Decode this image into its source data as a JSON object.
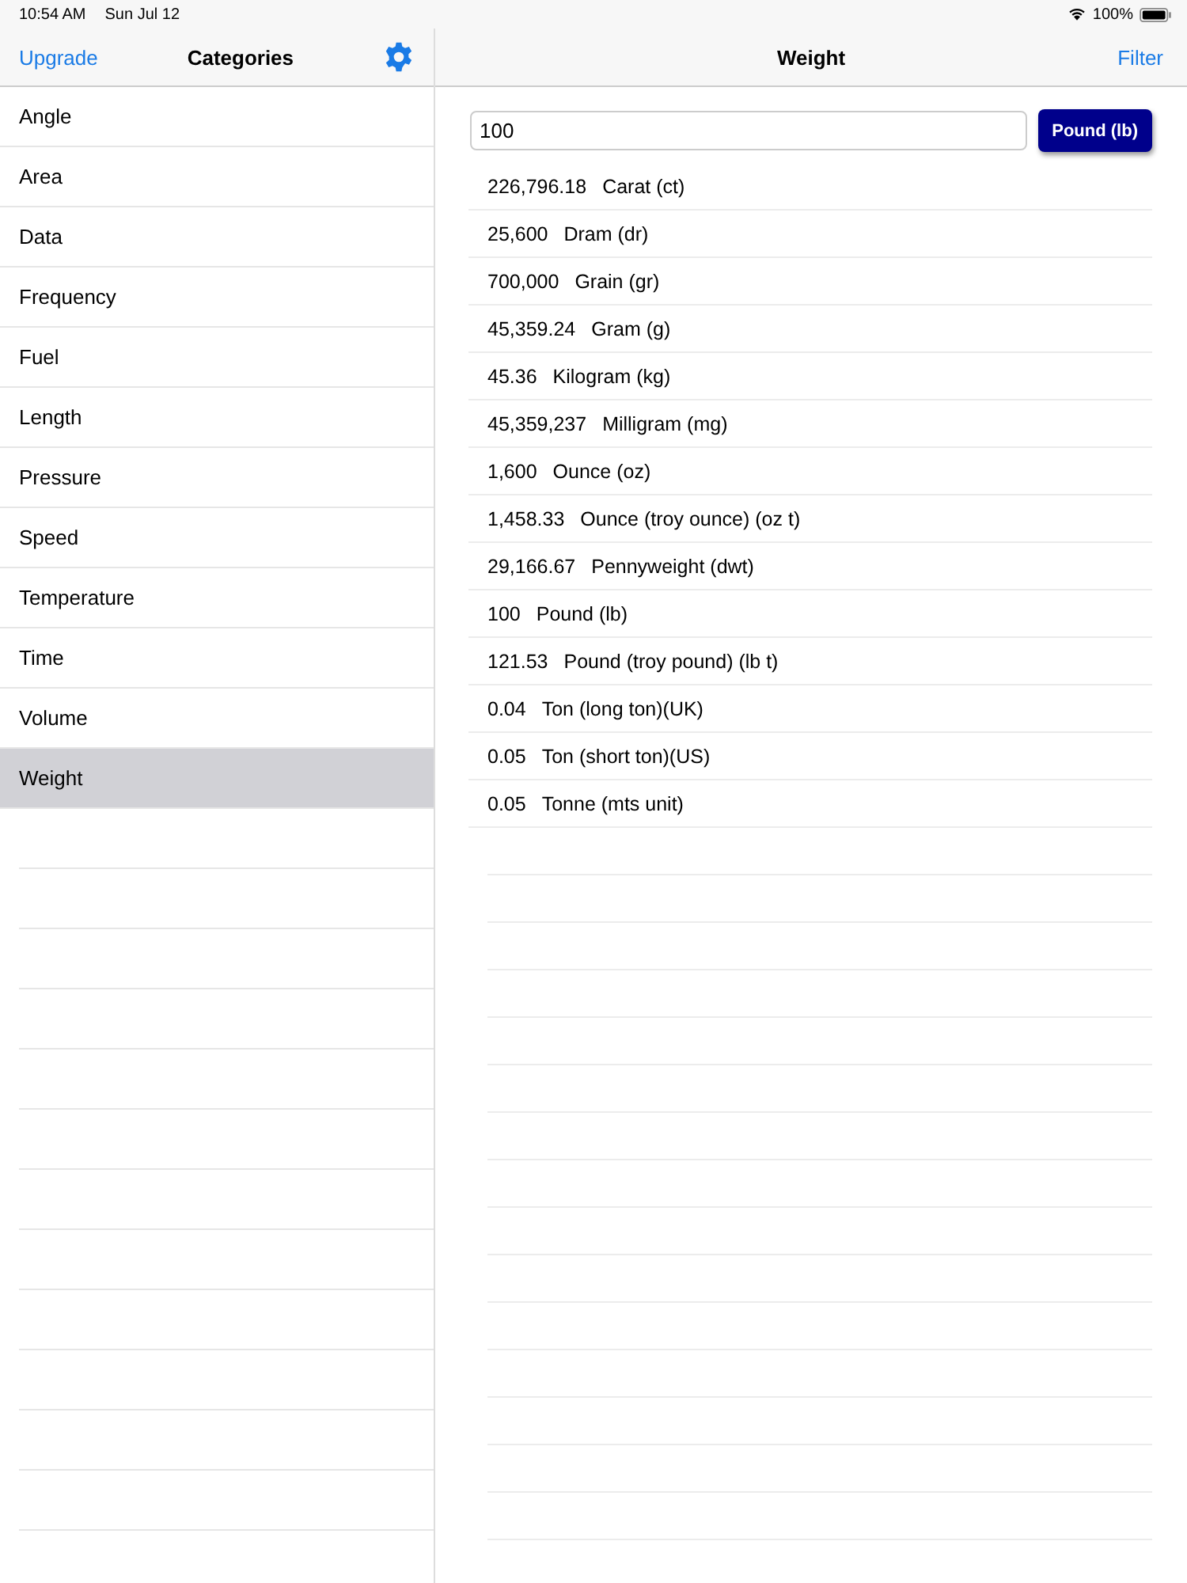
{
  "status_bar": {
    "time": "10:54 AM",
    "date": "Sun Jul 12",
    "battery": "100%"
  },
  "sidebar": {
    "upgrade": "Upgrade",
    "title": "Categories",
    "items": [
      {
        "label": "Angle",
        "selected": false
      },
      {
        "label": "Area",
        "selected": false
      },
      {
        "label": "Data",
        "selected": false
      },
      {
        "label": "Frequency",
        "selected": false
      },
      {
        "label": "Fuel",
        "selected": false
      },
      {
        "label": "Length",
        "selected": false
      },
      {
        "label": "Pressure",
        "selected": false
      },
      {
        "label": "Speed",
        "selected": false
      },
      {
        "label": "Temperature",
        "selected": false
      },
      {
        "label": "Time",
        "selected": false
      },
      {
        "label": "Volume",
        "selected": false
      },
      {
        "label": "Weight",
        "selected": true
      }
    ]
  },
  "main": {
    "title": "Weight",
    "filter": "Filter",
    "input": {
      "value": "100"
    },
    "unit_button": "Pound (lb)",
    "results": [
      {
        "value": "226,796.18",
        "unit": "Carat (ct)"
      },
      {
        "value": "25,600",
        "unit": "Dram (dr)"
      },
      {
        "value": "700,000",
        "unit": "Grain (gr)"
      },
      {
        "value": "45,359.24",
        "unit": "Gram (g)"
      },
      {
        "value": "45.36",
        "unit": "Kilogram (kg)"
      },
      {
        "value": "45,359,237",
        "unit": "Milligram (mg)"
      },
      {
        "value": "1,600",
        "unit": "Ounce (oz)"
      },
      {
        "value": "1,458.33",
        "unit": "Ounce (troy ounce) (oz t)"
      },
      {
        "value": "29,166.67",
        "unit": "Pennyweight (dwt)"
      },
      {
        "value": "100",
        "unit": "Pound (lb)"
      },
      {
        "value": "121.53",
        "unit": "Pound (troy pound) (lb t)"
      },
      {
        "value": "0.04",
        "unit": "Ton (long ton)(UK)"
      },
      {
        "value": "0.05",
        "unit": "Ton (short ton)(US)"
      },
      {
        "value": "0.05",
        "unit": "Tonne (mts unit)"
      }
    ]
  }
}
